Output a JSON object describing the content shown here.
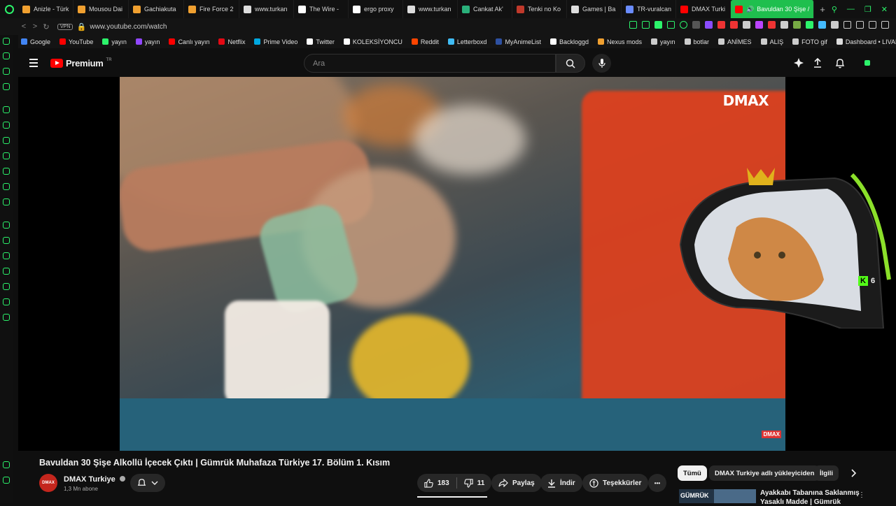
{
  "browser": {
    "tabs": [
      {
        "label": "Anizle - Türk",
        "color": "#f0a030"
      },
      {
        "label": "Mousou Dai",
        "color": "#f0a030"
      },
      {
        "label": "Gachiakuta",
        "color": "#f0a030"
      },
      {
        "label": "Fire Force 2",
        "color": "#f0a030"
      },
      {
        "label": "www.turkan",
        "color": "#dddddd"
      },
      {
        "label": "The Wire -",
        "color": "#ffffff"
      },
      {
        "label": "ergo proxy",
        "color": "#ffffff"
      },
      {
        "label": "www.turkan",
        "color": "#dddddd"
      },
      {
        "label": "Cankat Ak'",
        "color": "#2ab07a"
      },
      {
        "label": "Tenki no Ko",
        "color": "#c0392b"
      },
      {
        "label": "Games | Ba",
        "color": "#dddddd"
      },
      {
        "label": "TR-vuralcan",
        "color": "#6a8cff"
      },
      {
        "label": "DMAX Turki",
        "color": "#ff0000"
      }
    ],
    "active_tab": "Bavuldan 30 Şişe /",
    "new_tab": "+",
    "url": "www.youtube.com/watch",
    "vpn_label": "VPN",
    "bookmarks": [
      {
        "label": "Google",
        "color": "#4285f4"
      },
      {
        "label": "YouTube",
        "color": "#ff0000"
      },
      {
        "label": "yayın",
        "color": "#2cf36b"
      },
      {
        "label": "yayın",
        "color": "#9147ff"
      },
      {
        "label": "Canlı yayın",
        "color": "#ff0000"
      },
      {
        "label": "Netflix",
        "color": "#e50914"
      },
      {
        "label": "Prime Video",
        "color": "#00a8e1"
      },
      {
        "label": "Twitter",
        "color": "#ffffff"
      },
      {
        "label": "KOLEKSİYONCU",
        "color": "#ffffff"
      },
      {
        "label": "Reddit",
        "color": "#ff4500"
      },
      {
        "label": "Letterboxd",
        "color": "#40bcf4"
      },
      {
        "label": "MyAnimeList",
        "color": "#2e51a2"
      },
      {
        "label": "Backloggd",
        "color": "#ffffff"
      },
      {
        "label": "Nexus mods",
        "color": "#f0a030"
      },
      {
        "label": "yayın",
        "color": "#cccccc"
      },
      {
        "label": "botlar",
        "color": "#cccccc"
      },
      {
        "label": "ANİMES",
        "color": "#cccccc"
      },
      {
        "label": "ALIŞ",
        "color": "#cccccc"
      },
      {
        "label": "FOTO gif",
        "color": "#cccccc"
      },
      {
        "label": "Dashboard • LIVAD",
        "color": "#dddddd"
      }
    ]
  },
  "youtube": {
    "brand": "Premium",
    "region": "TR",
    "search_placeholder": "Ara",
    "video": {
      "watermark": "DMAX",
      "corner_mark": "DMAX",
      "kick_count": "6"
    },
    "title": "Bavuldan 30 Şişe Alkollü İçecek Çıktı | Gümrük Muhafaza Türkiye 17. Bölüm 1. Kısım",
    "channel": {
      "name": "DMAX Turkiye",
      "avatar_text": "DMAX",
      "subscribers": "1,3 Mn abone"
    },
    "actions": {
      "likes": "183",
      "dislikes": "11",
      "share": "Paylaş",
      "download": "İndir",
      "thanks": "Teşekkürler",
      "more": "•••"
    },
    "chips": [
      "Tümü",
      "DMAX Turkiye adlı yükleyiciden",
      "İlgili"
    ],
    "recommendation": {
      "title": "Ayakkabı Tabanına Saklanmış",
      "subtitle": "Yasaklı Madde | Gümrük",
      "thumb_text": "GÜMRÜK"
    }
  },
  "colors": {
    "accent": "#2cf36b",
    "yt_red": "#ff0000",
    "bg": "#0f0f0f"
  }
}
